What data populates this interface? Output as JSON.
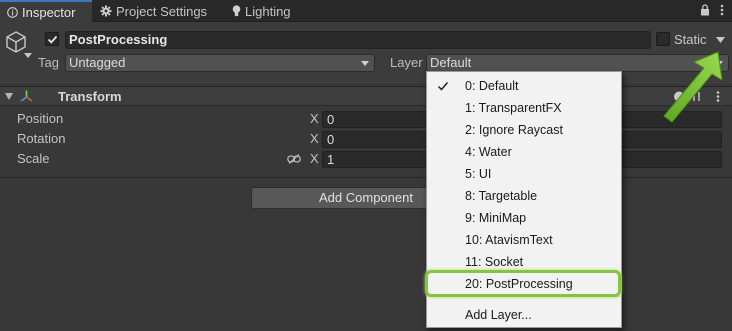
{
  "tabs": [
    {
      "label": "Inspector",
      "icon": "info-icon",
      "active": true
    },
    {
      "label": "Project Settings",
      "icon": "gear-icon",
      "active": false
    },
    {
      "label": "Lighting",
      "icon": "lightbulb-icon",
      "active": false
    }
  ],
  "object": {
    "name": "PostProcessing",
    "active": true,
    "static_label": "Static",
    "static_checked": false,
    "tag_label": "Tag",
    "tag_value": "Untagged",
    "layer_label": "Layer",
    "layer_value": "Default"
  },
  "transform": {
    "title": "Transform",
    "rows": [
      {
        "label": "Position",
        "axis": "X",
        "value": "0"
      },
      {
        "label": "Rotation",
        "axis": "X",
        "value": "0"
      },
      {
        "label": "Scale",
        "axis": "X",
        "value": "1"
      }
    ]
  },
  "add_component_label": "Add Component",
  "layer_menu": {
    "items": [
      {
        "label": "0: Default",
        "checked": true
      },
      {
        "label": "1: TransparentFX",
        "checked": false
      },
      {
        "label": "2: Ignore Raycast",
        "checked": false
      },
      {
        "label": "4: Water",
        "checked": false
      },
      {
        "label": "5: UI",
        "checked": false
      },
      {
        "label": "8: Targetable",
        "checked": false
      },
      {
        "label": "9: MiniMap",
        "checked": false
      },
      {
        "label": "10: AtavismText",
        "checked": false
      },
      {
        "label": "11: Socket",
        "checked": false
      },
      {
        "label": "20: PostProcessing",
        "checked": false,
        "highlighted": true
      }
    ],
    "add_layer_label": "Add Layer..."
  },
  "colors": {
    "highlight": "#86c440",
    "arrow": "#7cc034",
    "tab_accent": "#3a79bb"
  }
}
